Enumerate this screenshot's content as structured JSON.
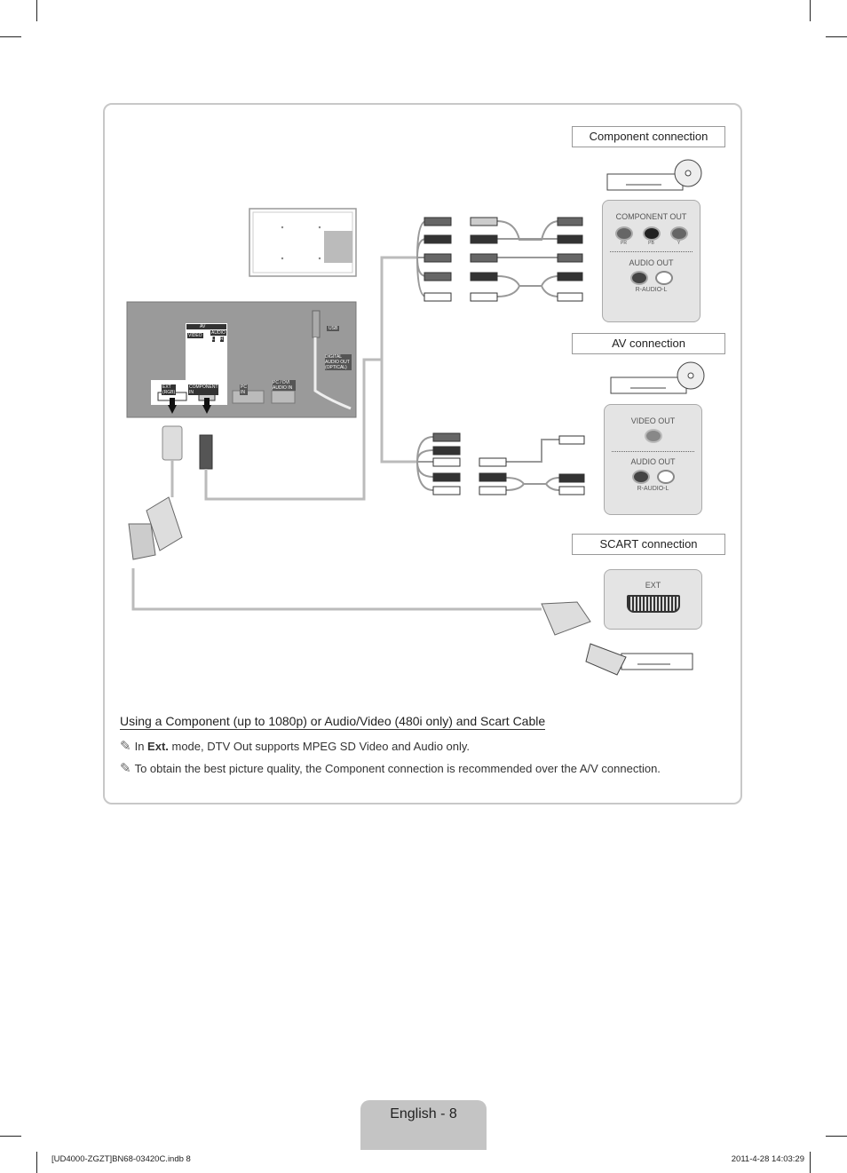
{
  "diagram": {
    "tv_panel": {
      "av_in": "AV IN",
      "video": "VIDEO",
      "audio": "AUDIO",
      "l": "L",
      "r": "R",
      "ext_rgb": "EXT (RGB)",
      "component_in": "COMPONENT IN",
      "pc_in": "PC IN",
      "pc_dvi_audio_in": "PC / DVI AUDIO IN",
      "usb": "USB",
      "digital_audio_out": "DIGITAL AUDIO OUT (OPTICAL)"
    },
    "component": {
      "title": "Component connection",
      "component_out": "COMPONENT OUT",
      "pr": "PR",
      "pb": "PB",
      "y": "Y",
      "audio_out": "AUDIO OUT",
      "r_audio_l": "R-AUDIO-L"
    },
    "av": {
      "title": "AV connection",
      "video_out": "VIDEO OUT",
      "audio_out": "AUDIO OUT",
      "r_audio_l": "R-AUDIO-L"
    },
    "scart": {
      "title": "SCART connection",
      "ext": "EXT"
    }
  },
  "text": {
    "heading": "Using a Component (up to 1080p) or Audio/Video (480i only) and Scart Cable",
    "note1_pre": "In ",
    "note1_bold": "Ext.",
    "note1_post": " mode, DTV Out supports MPEG SD Video and Audio only.",
    "note2": "To obtain the best picture quality, the Component connection is recommended over the A/V connection.",
    "note_icon": "pencil-note-icon"
  },
  "footer": {
    "page_label": "English - 8",
    "file": "[UD4000-ZGZT]BN68-03420C.indb   8",
    "timestamp": "2011-4-28   14:03:29"
  }
}
